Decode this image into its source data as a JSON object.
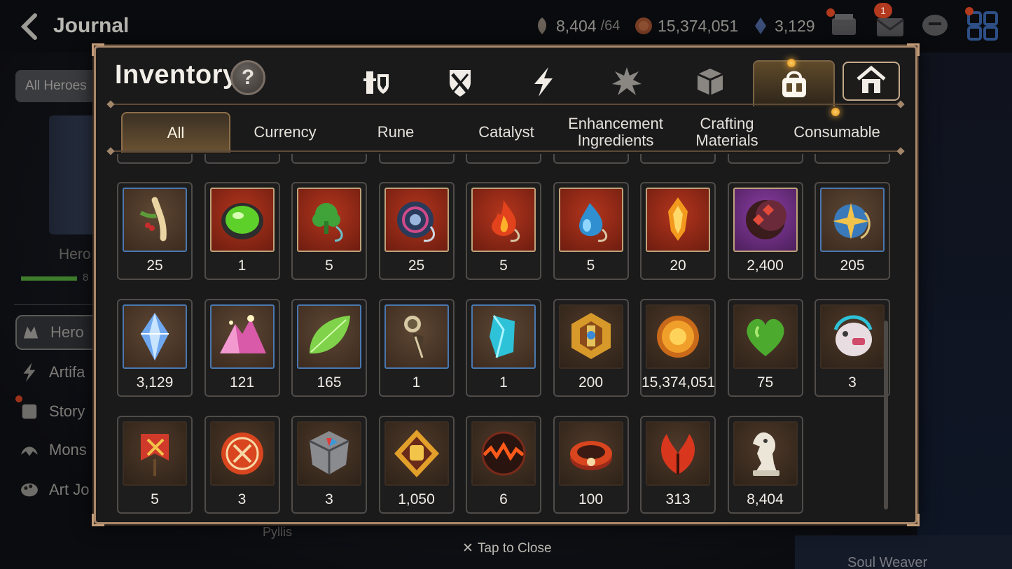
{
  "header": {
    "title": "Journal",
    "resources": [
      {
        "icon": "stamina-icon",
        "value": "8,404",
        "sub": "/64"
      },
      {
        "icon": "gold-coin-icon",
        "value": "15,374,051",
        "sub": ""
      },
      {
        "icon": "skystone-icon",
        "value": "3,129",
        "sub": ""
      }
    ],
    "mail_badge": "1"
  },
  "background": {
    "all_heroes": "All Heroes",
    "hero_label": "Hero",
    "bar_num": "8",
    "nav": [
      {
        "label": "Hero",
        "icon": "hero-icon"
      },
      {
        "label": "Artifa",
        "icon": "artifact-icon"
      },
      {
        "label": "Story",
        "icon": "story-icon"
      },
      {
        "label": "Mons",
        "icon": "monster-icon"
      },
      {
        "label": "Art Jo",
        "icon": "art-journal-icon"
      }
    ],
    "pyllis": "Pyllis",
    "soul_weaver": "Soul Weaver"
  },
  "modal": {
    "title": "Inventory",
    "help": "?",
    "categories": [
      "equipment-icon",
      "shield-sword-icon",
      "lightning-icon",
      "burst-icon",
      "cube-icon",
      "bag-icon",
      "house-icon"
    ],
    "active_category": "bag-icon",
    "tabs": [
      "All",
      "Currency",
      "Rune",
      "Catalyst",
      "Enhancement Ingredients",
      "Crafting Materials",
      "Consumable"
    ],
    "active_tab": "All",
    "items": [
      {
        "qty": "25",
        "frame": "blue",
        "icon": "ginseng-icon"
      },
      {
        "qty": "1",
        "frame": "red",
        "icon": "green-orb-icon"
      },
      {
        "qty": "5",
        "frame": "red",
        "icon": "tree-pendant-icon"
      },
      {
        "qty": "25",
        "frame": "red",
        "icon": "spiral-rune-icon"
      },
      {
        "qty": "5",
        "frame": "red",
        "icon": "fire-pendant-icon"
      },
      {
        "qty": "5",
        "frame": "red",
        "icon": "water-pendant-icon"
      },
      {
        "qty": "20",
        "frame": "red",
        "icon": "flame-crystal-icon"
      },
      {
        "qty": "2,400",
        "frame": "purple",
        "icon": "crescent-rune-icon"
      },
      {
        "qty": "205",
        "frame": "blue",
        "icon": "star-pendant-icon"
      },
      {
        "qty": "3,129",
        "frame": "blue",
        "icon": "blue-crystal-icon"
      },
      {
        "qty": "121",
        "frame": "blue",
        "icon": "pink-mountain-icon"
      },
      {
        "qty": "165",
        "frame": "blue",
        "icon": "leaf-icon"
      },
      {
        "qty": "1",
        "frame": "blue",
        "icon": "dagger-charm-icon"
      },
      {
        "qty": "1",
        "frame": "blue",
        "icon": "cyan-shard-icon"
      },
      {
        "qty": "200",
        "frame": "brown",
        "icon": "gold-emblem-icon"
      },
      {
        "qty": "15,374,051",
        "frame": "brown",
        "icon": "gold-coin-icon"
      },
      {
        "qty": "75",
        "frame": "brown",
        "icon": "green-heart-icon"
      },
      {
        "qty": "3",
        "frame": "brown",
        "icon": "pet-toy-icon"
      },
      {
        "qty": "5",
        "frame": "brown",
        "icon": "banner-icon"
      },
      {
        "qty": "3",
        "frame": "brown",
        "icon": "red-seal-icon"
      },
      {
        "qty": "3",
        "frame": "brown",
        "icon": "stone-cube-icon"
      },
      {
        "qty": "1,050",
        "frame": "brown",
        "icon": "fist-emblem-icon"
      },
      {
        "qty": "6",
        "frame": "brown",
        "icon": "lava-orb-icon"
      },
      {
        "qty": "100",
        "frame": "brown",
        "icon": "red-bracelet-icon"
      },
      {
        "qty": "313",
        "frame": "brown",
        "icon": "red-leaf-icon"
      },
      {
        "qty": "8,404",
        "frame": "brown",
        "icon": "chess-knight-icon"
      }
    ]
  },
  "footer": {
    "close": "Tap to Close"
  }
}
